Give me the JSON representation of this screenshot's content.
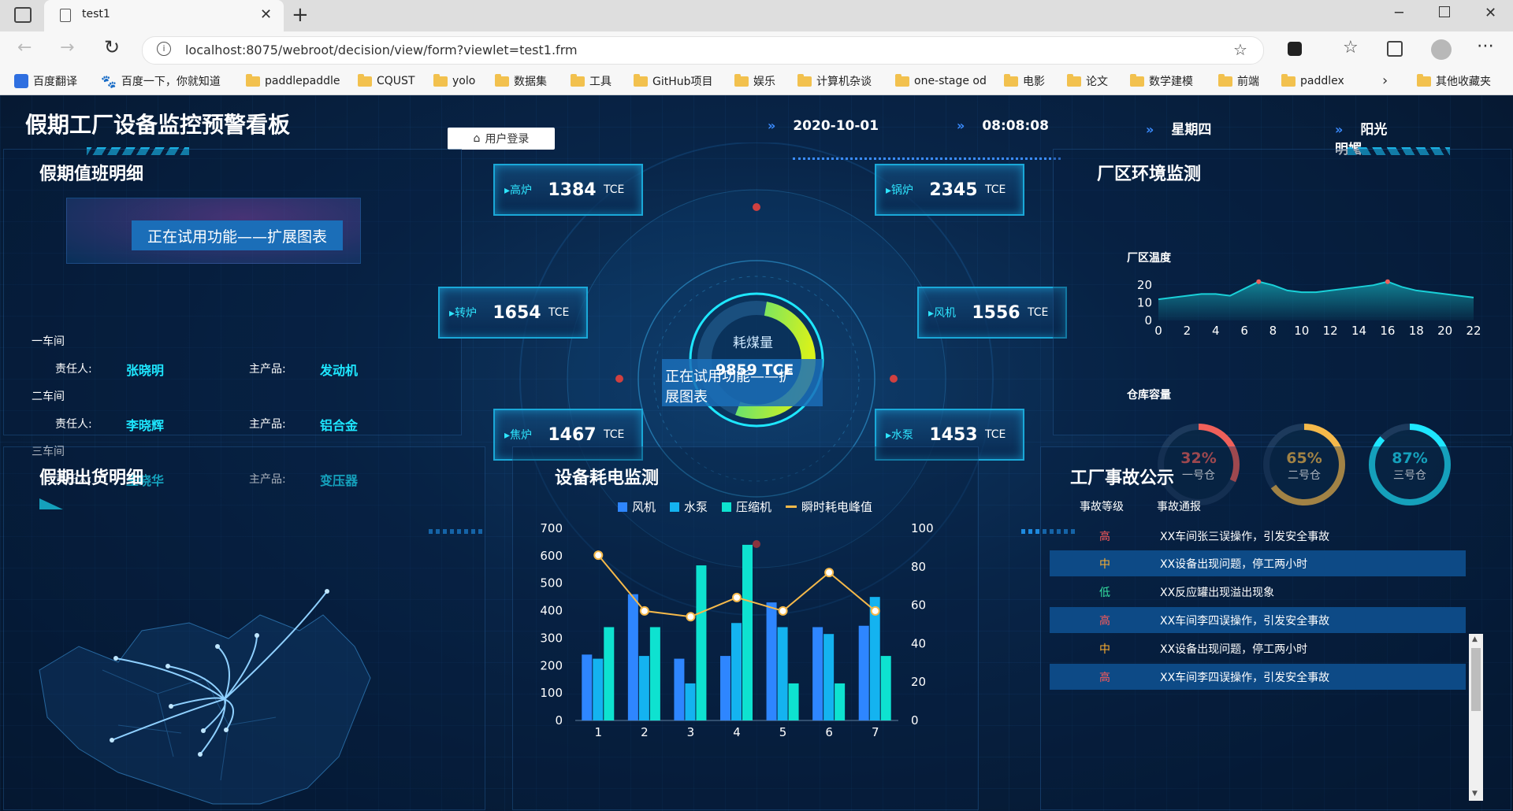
{
  "browser": {
    "tab_title": "test1",
    "url": "localhost:8075/webroot/decision/view/form?viewlet=test1.frm",
    "bookmarks": [
      "百度翻译",
      "百度一下，你就知道",
      "paddlepaddle",
      "CQUST",
      "yolo",
      "数据集",
      "工具",
      "GitHub项目",
      "娱乐",
      "计算机杂谈",
      "one-stage od",
      "电影",
      "论文",
      "数学建模",
      "前端",
      "paddlex",
      "其他收藏夹"
    ]
  },
  "header": {
    "title": "假期工厂设备监控预警看板",
    "login_label": "用户登录",
    "date": "2020-10-01",
    "time": "08:08:08",
    "weekday": "星期四",
    "weather": "阳光明媚"
  },
  "duty": {
    "title": "假期值班明细",
    "trial_text": "正在试用功能——扩展图表",
    "person_label": "责任人:",
    "product_label": "主产品:",
    "rows": [
      {
        "workshop": "一车间",
        "person": "张晓明",
        "product": "发动机"
      },
      {
        "workshop": "二车间",
        "person": "李晓辉",
        "product": "铝合金"
      },
      {
        "workshop": "三车间",
        "person": "王晓华",
        "product": "变压器"
      }
    ]
  },
  "center": {
    "gauge_label": "耗煤量",
    "gauge_value": "9859 TCE",
    "trial_text_1": "正在试用功能——扩",
    "trial_text_2": "展图表",
    "unit": "TCE",
    "metrics": [
      {
        "label": "高炉",
        "value": "1384"
      },
      {
        "label": "锅炉",
        "value": "2345"
      },
      {
        "label": "转炉",
        "value": "1654"
      },
      {
        "label": "风机",
        "value": "1556"
      },
      {
        "label": "焦炉",
        "value": "1467"
      },
      {
        "label": "水泵",
        "value": "1453"
      }
    ]
  },
  "env": {
    "title": "厂区环境监测",
    "temp_label": "厂区温度",
    "store_label": "仓库容量",
    "rings": [
      {
        "pct": "32%",
        "name": "一号仓",
        "value": 0.32,
        "color": "#f0605a"
      },
      {
        "pct": "65%",
        "name": "二号仓",
        "value": 0.65,
        "color": "#f5b94a"
      },
      {
        "pct": "87%",
        "name": "三号仓",
        "value": 0.87,
        "color": "#1ee7ff"
      }
    ]
  },
  "shipping": {
    "title": "假期出货明细"
  },
  "power": {
    "title": "设备耗电监测",
    "legend": [
      "风机",
      "水泵",
      "压缩机",
      "瞬时耗电峰值"
    ]
  },
  "accidents": {
    "title": "工厂事故公示",
    "col_level": "事故等级",
    "col_report": "事故通报",
    "rows": [
      {
        "level": "高",
        "text": "XX车间张三误操作，引发安全事故",
        "color": "#ff5a5a"
      },
      {
        "level": "中",
        "text": "XX设备出现问题，停工两小时",
        "color": "#ffb030"
      },
      {
        "level": "低",
        "text": "XX反应罐出现溢出现象",
        "color": "#34e0a1"
      },
      {
        "level": "高",
        "text": "XX车间李四误操作，引发安全事故",
        "color": "#ff5a5a"
      },
      {
        "level": "中",
        "text": "XX设备出现问题，停工两小时",
        "color": "#ffb030"
      },
      {
        "level": "高",
        "text": "XX车间李四误操作，引发安全事故",
        "color": "#ff5a5a"
      }
    ]
  },
  "chart_data": [
    {
      "type": "area",
      "title": "厂区温度",
      "x": [
        0,
        1,
        2,
        3,
        4,
        5,
        6,
        7,
        8,
        9,
        10,
        11,
        12,
        13,
        14,
        15,
        16,
        17,
        18,
        19,
        20,
        21,
        22
      ],
      "values": [
        12,
        13,
        14,
        15,
        15,
        14,
        18,
        22,
        20,
        17,
        16,
        16,
        17,
        18,
        19,
        20,
        22,
        19,
        17,
        16,
        15,
        14,
        13
      ],
      "xticks": [
        "0",
        "2",
        "4",
        "6",
        "8",
        "10",
        "12",
        "14",
        "16",
        "18",
        "20",
        "22"
      ],
      "yticks": [
        "0",
        "10",
        "20"
      ],
      "ylim": [
        0,
        25
      ],
      "color": "#1ad0d8"
    },
    {
      "type": "bar",
      "title": "设备耗电监测",
      "categories": [
        "1",
        "2",
        "3",
        "4",
        "5",
        "6",
        "7"
      ],
      "series": [
        {
          "name": "风机",
          "values": [
            240,
            460,
            225,
            235,
            430,
            340,
            345
          ],
          "color": "#2e86ff"
        },
        {
          "name": "水泵",
          "values": [
            225,
            235,
            135,
            355,
            340,
            315,
            450
          ],
          "color": "#14b3f0"
        },
        {
          "name": "压缩机",
          "values": [
            340,
            340,
            565,
            640,
            135,
            135,
            235
          ],
          "color": "#0ee2d0"
        },
        {
          "name": "瞬时耗电峰值",
          "type": "line",
          "axis": "right",
          "values": [
            86,
            57,
            54,
            64,
            57,
            77,
            57
          ],
          "color": "#f5b94a"
        }
      ],
      "yticks_left": [
        "0",
        "100",
        "200",
        "300",
        "400",
        "500",
        "600",
        "700"
      ],
      "yticks_right": [
        "0",
        "20",
        "40",
        "60",
        "80",
        "100"
      ],
      "ylim": [
        0,
        700
      ],
      "ylim_right": [
        0,
        100
      ]
    }
  ]
}
